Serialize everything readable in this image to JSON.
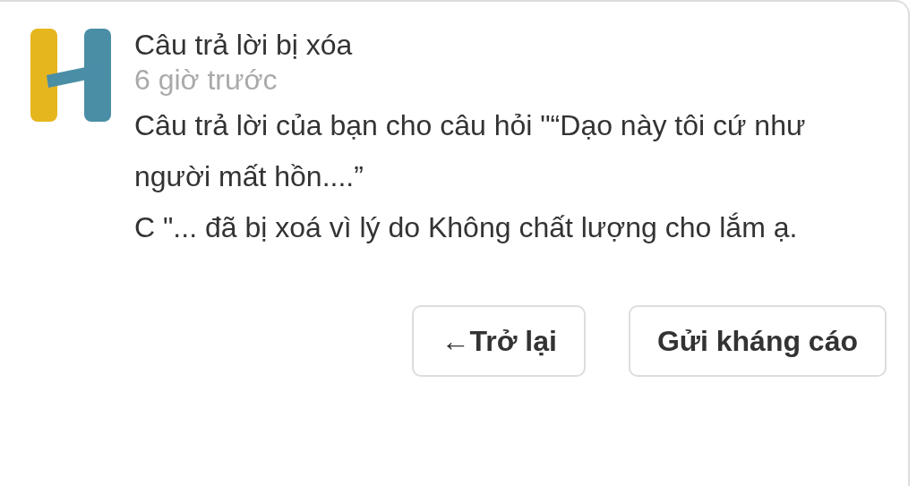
{
  "notification": {
    "title": "Câu trả lời bị xóa",
    "time": "6 giờ trước",
    "message": "Câu trả lời của bạn cho câu hỏi \"“Dạo này tôi cứ như người mất hồn....”\nC \"... đã bị xoá vì lý do Không chất lượng cho lắm ạ."
  },
  "buttons": [
    {
      "label": "←Trở lại"
    },
    {
      "label": "Gửi kháng cáo"
    }
  ]
}
